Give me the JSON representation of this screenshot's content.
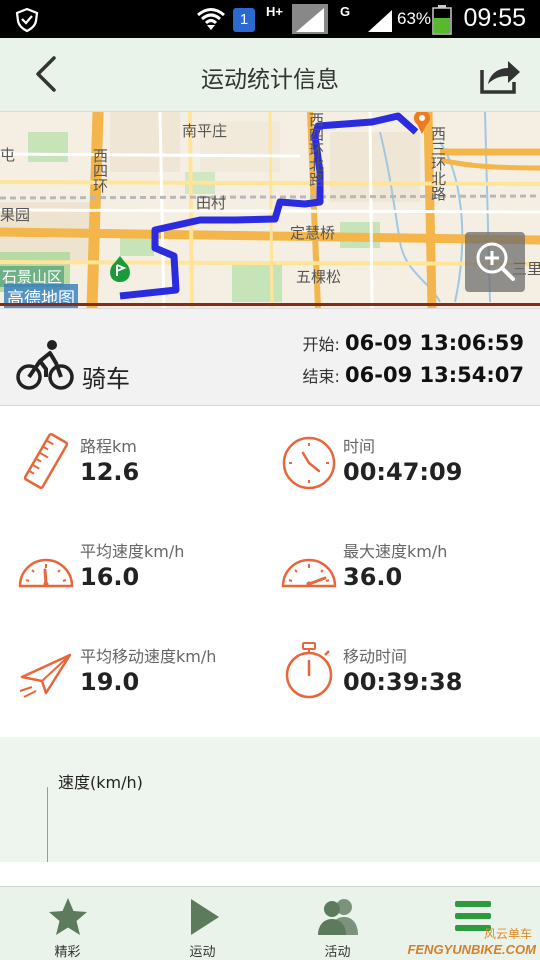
{
  "status_bar": {
    "network_type": "H+",
    "network_type_2": "G",
    "sim_badge": "1",
    "battery_percent": "63%",
    "time": "09:55"
  },
  "header": {
    "title": "运动统计信息",
    "back_icon": "chevron-left-icon",
    "share_icon": "share-icon"
  },
  "map": {
    "labels": {
      "nanpingzhuang": "南平庄",
      "tiancun": "田村",
      "dinghuiqiao": "定慧桥",
      "wukesong": "五棵松",
      "xisihuan_bei": "西四环北路",
      "xisanhuan_bei": "西三环北路",
      "xisihuan": "西四环",
      "guoyuan": "果园",
      "dian": "屯",
      "shijingshan": "石景山区",
      "sanli": "三里"
    },
    "logo": "高德地图",
    "zoom_icon": "zoom-in-icon",
    "route_color": "#2b2be0",
    "start_marker_color": "#1a9a3a",
    "end_marker_color": "#f07a1e"
  },
  "activity": {
    "icon": "bicycle-icon",
    "type": "骑车",
    "start_label": "开始:",
    "start_time": "06-09 13:06:59",
    "end_label": "结束:",
    "end_time": "06-09 13:54:07"
  },
  "stats": {
    "distance": {
      "label": "路程km",
      "value": "12.6",
      "icon": "ruler-icon"
    },
    "duration": {
      "label": "时间",
      "value": "00:47:09",
      "icon": "clock-icon"
    },
    "avg_speed": {
      "label": "平均速度km/h",
      "value": "16.0",
      "icon": "speedometer-icon"
    },
    "max_speed": {
      "label": "最大速度km/h",
      "value": "36.0",
      "icon": "speedometer-icon"
    },
    "avg_moving_speed": {
      "label": "平均移动速度km/h",
      "value": "19.0",
      "icon": "paper-plane-icon"
    },
    "moving_time": {
      "label": "移动时间",
      "value": "00:39:38",
      "icon": "stopwatch-icon"
    }
  },
  "accent_color": "#e8663a",
  "chart": {
    "ylabel": "速度(km/h)"
  },
  "bottom_nav": {
    "items": [
      {
        "label": "精彩",
        "icon": "star-icon"
      },
      {
        "label": "运动",
        "icon": "play-icon"
      },
      {
        "label": "活动",
        "icon": "people-icon"
      },
      {
        "label": "",
        "icon": "menu-icon"
      }
    ]
  },
  "watermark": {
    "text": "FENGYUNBIKE.COM",
    "text_cn": "风云单车"
  }
}
